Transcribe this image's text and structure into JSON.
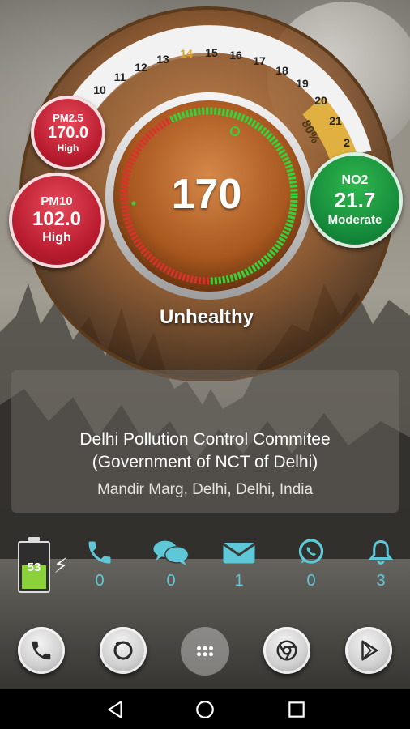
{
  "gauge": {
    "aqi_value": "170",
    "status": "Unhealthy",
    "percent": "80%",
    "days": [
      "10",
      "11",
      "12",
      "13",
      "14",
      "15",
      "16",
      "17",
      "18",
      "19",
      "20",
      "21",
      "2"
    ],
    "today": "14",
    "colors": {
      "bad": "#d8332b",
      "good": "#33d33c",
      "accent": "#e0a020"
    }
  },
  "pollutants": {
    "pm25": {
      "name": "PM2.5",
      "value": "170.0",
      "level": "High"
    },
    "pm10": {
      "name": "PM10",
      "value": "102.0",
      "level": "High"
    },
    "no2": {
      "name": "NO2",
      "value": "21.7",
      "level": "Moderate"
    }
  },
  "station": {
    "line1": "Delhi Pollution Control Commitee",
    "line2": "(Government of NCT of Delhi)",
    "location": "Mandir Marg, Delhi, Delhi, India"
  },
  "status_row": {
    "battery": "53",
    "battery_level": 0.53,
    "calls": "0",
    "messages": "0",
    "email": "1",
    "whatsapp": "0",
    "alerts": "3"
  },
  "dock": {
    "icons": [
      "phone-icon",
      "camera-icon",
      "apps-icon",
      "chrome-icon",
      "play-store-icon"
    ]
  },
  "navbar": {
    "icons": [
      "back-icon",
      "home-icon",
      "recents-icon"
    ]
  }
}
